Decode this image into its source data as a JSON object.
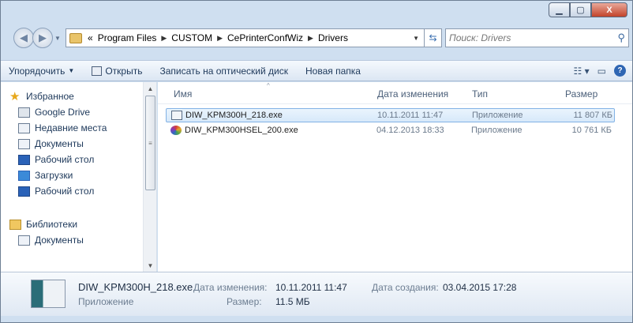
{
  "window": {
    "min_icon": "minimize-icon",
    "max_icon": "maximize-icon",
    "close_label": "X"
  },
  "address": {
    "overflow": "«",
    "crumbs": [
      "Program Files",
      "CUSTOM",
      "CePrinterConfWiz",
      "Drivers"
    ],
    "search_placeholder": "Поиск: Drivers"
  },
  "toolbar": {
    "organize": "Упорядочить",
    "open": "Открыть",
    "burn": "Записать на оптический диск",
    "new_folder": "Новая папка"
  },
  "nav": {
    "favorites": "Избранное",
    "google_drive": "Google Drive",
    "recent": "Недавние места",
    "documents": "Документы",
    "desktop": "Рабочий стол",
    "downloads": "Загрузки",
    "desktop2": "Рабочий стол",
    "libraries": "Библиотеки",
    "lib_documents": "Документы"
  },
  "columns": {
    "name": "Имя",
    "date": "Дата изменения",
    "type": "Тип",
    "size": "Размер"
  },
  "files": [
    {
      "name": "DIW_KPM300H_218.exe",
      "date": "10.11.2011 11:47",
      "type": "Приложение",
      "size": "11 807 КБ",
      "selected": true
    },
    {
      "name": "DIW_KPM300HSEL_200.exe",
      "date": "04.12.2013 18:33",
      "type": "Приложение",
      "size": "10 761 КБ",
      "selected": false
    }
  ],
  "details": {
    "filename": "DIW_KPM300H_218.exe",
    "kind": "Приложение",
    "modified_label": "Дата изменения:",
    "modified_value": "10.11.2011 11:47",
    "size_label": "Размер:",
    "size_value": "11.5 МБ",
    "created_label": "Дата создания:",
    "created_value": "03.04.2015 17:28"
  }
}
